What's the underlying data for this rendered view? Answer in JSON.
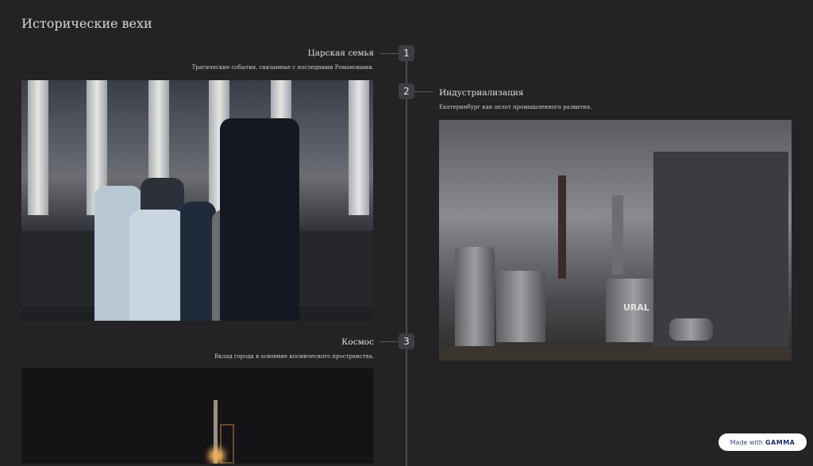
{
  "page": {
    "title": "Исторические вехи"
  },
  "timeline": [
    {
      "number": "1",
      "heading": "Царская семья",
      "description": "Трагические события, связанные с последними Романовыми.",
      "image": "tsar-family-photo"
    },
    {
      "number": "2",
      "heading": "Индустриализация",
      "description": "Екатеринбург как оплот промышленного развития.",
      "image": "industrial-plant-photo",
      "image_text": "URAL"
    },
    {
      "number": "3",
      "heading": "Космос",
      "description": "Вклад города в освоение космического пространства.",
      "image": "rocket-launch-photo"
    }
  ],
  "badge": {
    "prefix": "Made with",
    "brand": "GAMMA"
  }
}
